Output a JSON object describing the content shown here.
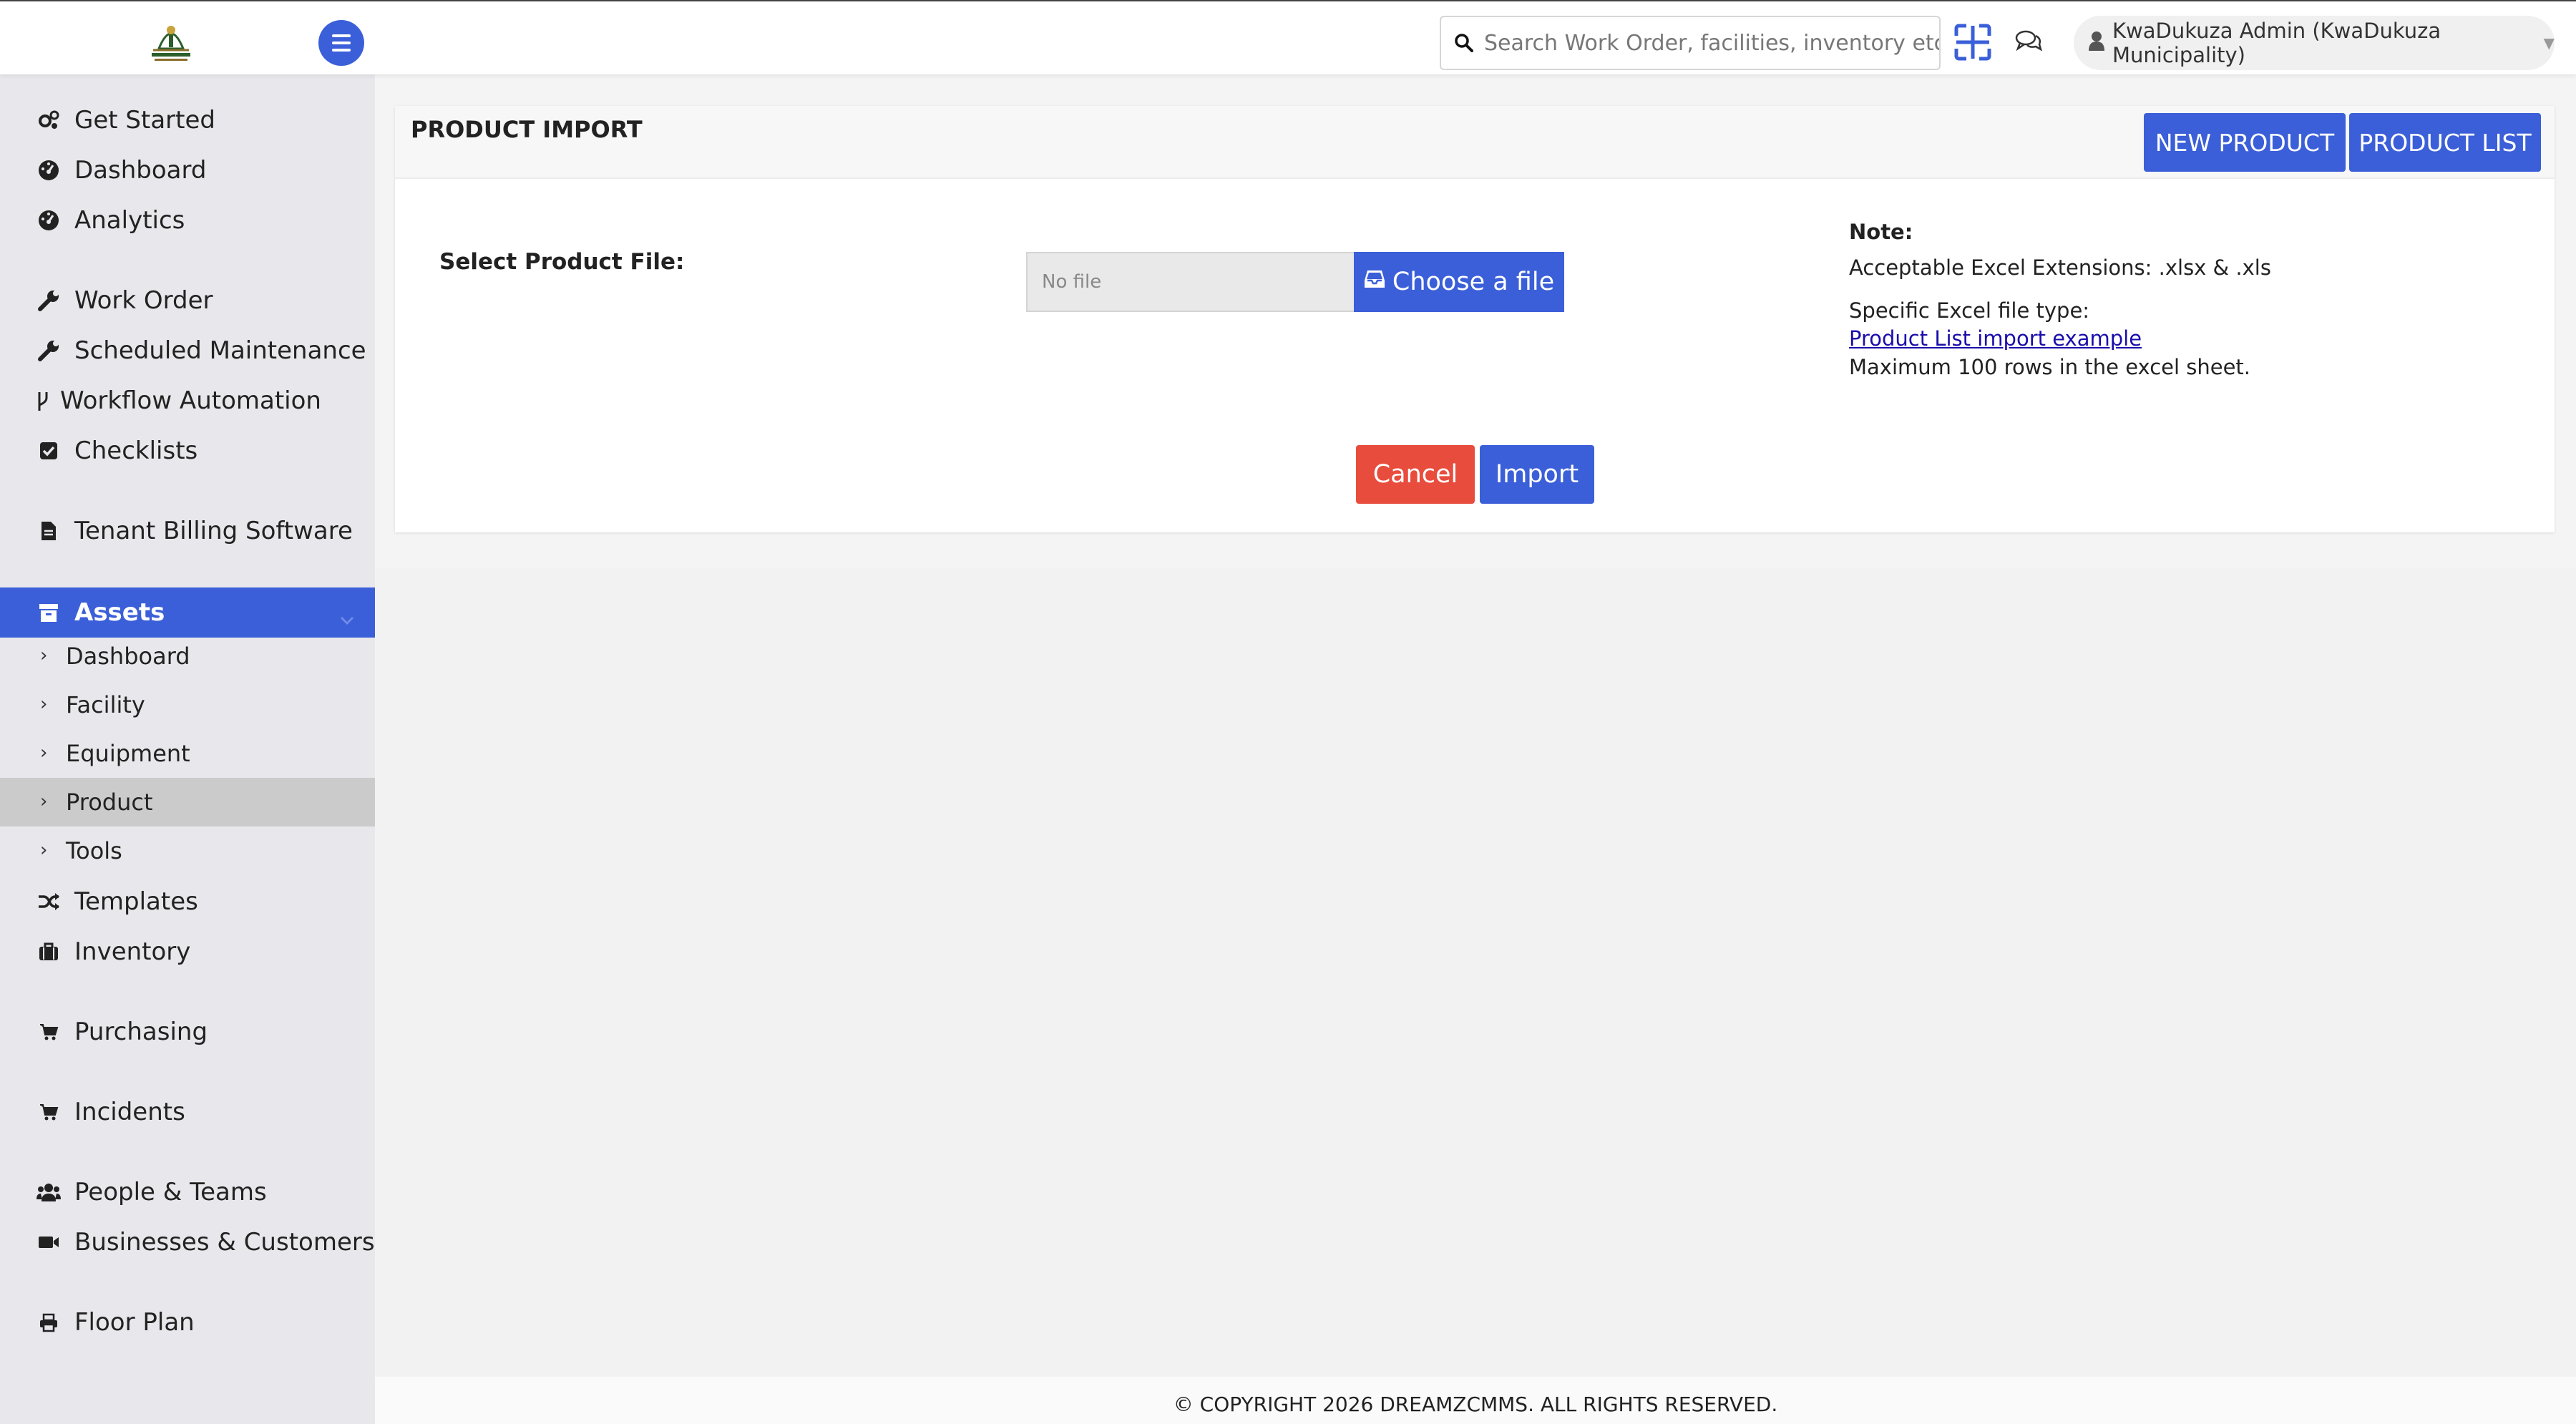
{
  "header": {
    "search_placeholder": "Search Work Order, facilities, inventory etc...",
    "user_label": "KwaDukuza Admin (KwaDukuza Municipality)"
  },
  "sidebar": {
    "items": [
      {
        "label": "Get Started",
        "icon": "cogs-icon"
      },
      {
        "label": "Dashboard",
        "icon": "gauge-icon"
      },
      {
        "label": "Analytics",
        "icon": "gauge-icon"
      },
      {
        "label": "Work Order",
        "icon": "wrench-icon"
      },
      {
        "label": "Scheduled Maintenance",
        "icon": "wrench-icon"
      },
      {
        "label": "Workflow Automation",
        "icon": "branch-icon"
      },
      {
        "label": "Checklists",
        "icon": "checkbox-icon"
      },
      {
        "label": "Tenant Billing Software",
        "icon": "document-icon"
      },
      {
        "label": "Assets",
        "icon": "archive-icon"
      },
      {
        "label": "Templates",
        "icon": "shuffle-icon"
      },
      {
        "label": "Inventory",
        "icon": "briefcase-icon"
      },
      {
        "label": "Purchasing",
        "icon": "cart-icon"
      },
      {
        "label": "Incidents",
        "icon": "cart-icon"
      },
      {
        "label": "People & Teams",
        "icon": "users-icon"
      },
      {
        "label": "Businesses & Customers",
        "icon": "video-icon"
      },
      {
        "label": "Floor Plan",
        "icon": "print-icon"
      }
    ],
    "assets_sub": [
      {
        "label": "Dashboard"
      },
      {
        "label": "Facility"
      },
      {
        "label": "Equipment"
      },
      {
        "label": "Product"
      },
      {
        "label": "Tools"
      }
    ]
  },
  "main": {
    "title": "PRODUCT IMPORT",
    "new_product_label": "NEW PRODUCT",
    "product_list_label": "PRODUCT LIST",
    "select_file_label": "Select Product File:",
    "file_placeholder": "No file",
    "choose_file_label": "Choose a file",
    "note": {
      "title": "Note:",
      "extensions": "Acceptable Excel Extensions: .xlsx & .xls",
      "file_type": "Specific Excel file type:",
      "example_link": "Product List import example",
      "max_rows": "Maximum 100 rows in the excel sheet."
    },
    "cancel_label": "Cancel",
    "import_label": "Import"
  },
  "footer": {
    "copyright": "© COPYRIGHT 2026 DREAMZCMMS. ALL RIGHTS RESERVED."
  },
  "colors": {
    "primary": "#3b5fd8",
    "danger": "#e84c3d",
    "sidebar_bg": "#e8e8ec",
    "selected_bg": "#cbcbcb"
  }
}
